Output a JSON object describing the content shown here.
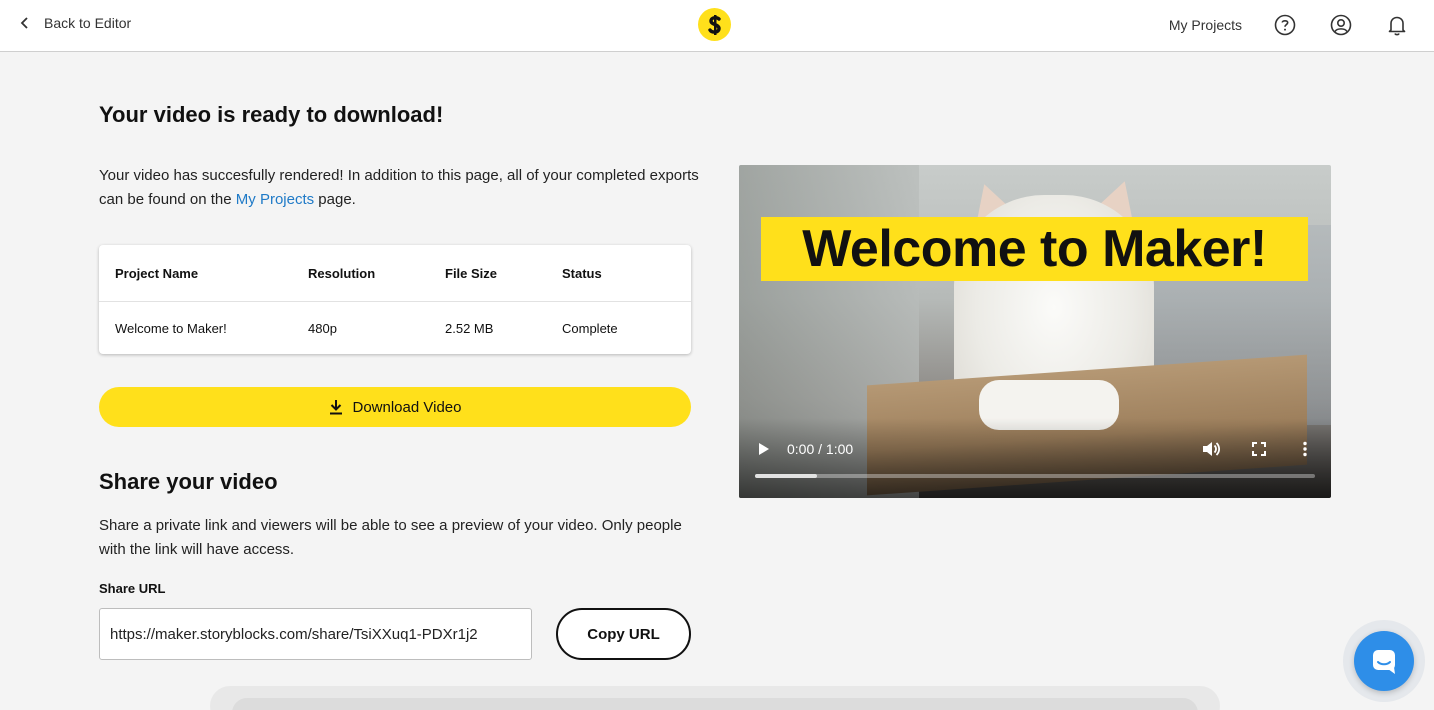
{
  "header": {
    "back_label": "Back to Editor",
    "logo_letter": "S",
    "my_projects_label": "My Projects",
    "icons": [
      "help-icon",
      "account-icon",
      "bell-icon"
    ]
  },
  "main": {
    "title": "Your video is ready to download!",
    "intro_before": "Your video has succesfully rendered! In addition to this page, all of your completed exports can be found on the ",
    "intro_link": "My Projects",
    "intro_after": " page.",
    "table": {
      "headers": [
        "Project Name",
        "Resolution",
        "File Size",
        "Status"
      ],
      "row": [
        "Welcome to Maker!",
        "480p",
        "2.52 MB",
        "Complete"
      ]
    },
    "download_label": "Download Video"
  },
  "share": {
    "title": "Share your video",
    "description": "Share a private link and viewers will be able to see a preview of your video. Only people with the link will have access.",
    "url_label": "Share URL",
    "url_value": "https://maker.storyblocks.com/share/TsiXXuq1-PDXr1j2",
    "copy_label": "Copy URL"
  },
  "video": {
    "banner_text": "Welcome to Maker!",
    "time": "0:00 / 1:00",
    "progress": 0.11
  },
  "colors": {
    "accent_yellow": "#ffe01b",
    "link_blue": "#1f7ac7",
    "chat_blue": "#2e8ee8"
  }
}
